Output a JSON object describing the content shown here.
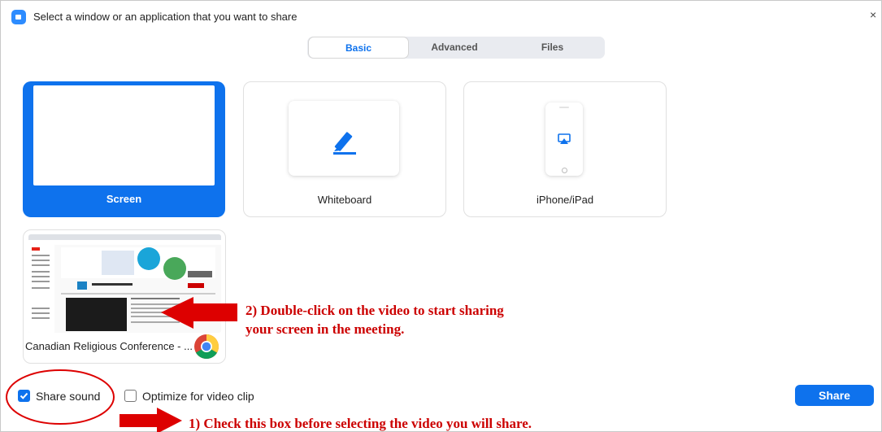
{
  "window": {
    "title": "Select a window or an application that you want to share",
    "close_glyph": "×"
  },
  "tabs": [
    {
      "label": "Basic",
      "active": true
    },
    {
      "label": "Advanced",
      "active": false
    },
    {
      "label": "Files",
      "active": false
    }
  ],
  "tiles": {
    "screen": {
      "label": "Screen",
      "selected": true
    },
    "whiteboard": {
      "label": "Whiteboard",
      "icon": "pen-icon"
    },
    "iphone": {
      "label": "iPhone/iPad",
      "icon": "airplay-icon"
    },
    "app_window": {
      "label": "Canadian Religious Conference - ...",
      "icon": "chrome-icon"
    }
  },
  "options": {
    "share_sound": {
      "label": "Share sound",
      "checked": true
    },
    "optimize_video": {
      "label": "Optimize for video clip",
      "checked": false
    }
  },
  "share_button": {
    "label": "Share"
  },
  "annotations": {
    "step2_line1": "2) Double-click on the video to start sharing",
    "step2_line2": "your screen in the meeting.",
    "step1": "1) Check this box before selecting the video you will share."
  },
  "colors": {
    "accent": "#0e72ed",
    "annotation": "#cc0000",
    "tab_bg": "#e9ebf0"
  }
}
